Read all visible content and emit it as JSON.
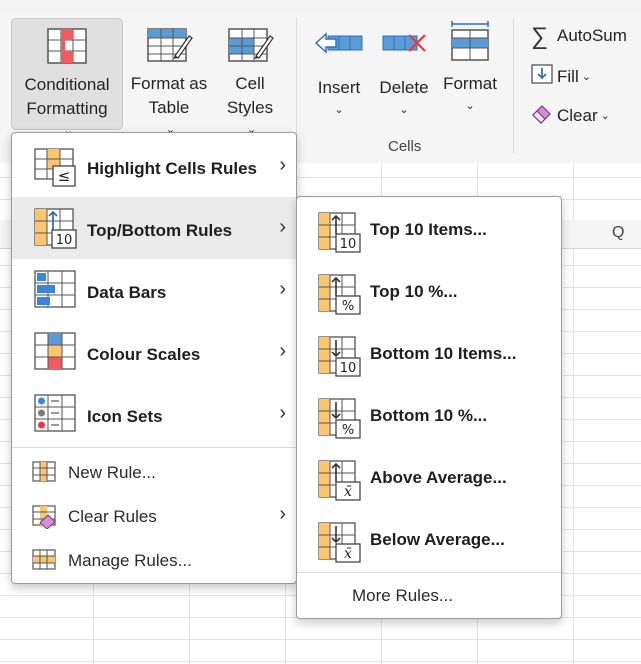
{
  "ribbon": {
    "conditional_formatting": {
      "line1": "Conditional",
      "line2": "Formatting"
    },
    "format_as_table": {
      "line1": "Format as",
      "line2": "Table"
    },
    "cell_styles": {
      "line1": "Cell",
      "line2": "Styles"
    },
    "insert": "Insert",
    "delete": "Delete",
    "format": "Format",
    "cells_group": "Cells",
    "autosum": "AutoSum",
    "fill": "Fill",
    "clear": "Clear",
    "chevron": "⌄"
  },
  "sheet": {
    "column_q": "Q"
  },
  "main_menu": {
    "items": [
      {
        "label": "Highlight Cells Rules",
        "icon": "highlight-cells-icon",
        "submenu": true
      },
      {
        "label": "Top/Bottom Rules",
        "icon": "top-bottom-icon",
        "submenu": true,
        "selected": true
      },
      {
        "label": "Data Bars",
        "icon": "data-bars-icon",
        "submenu": true
      },
      {
        "label": "Colour Scales",
        "icon": "colour-scales-icon",
        "submenu": true
      },
      {
        "label": "Icon Sets",
        "icon": "icon-sets-icon",
        "submenu": true
      }
    ],
    "actions": [
      {
        "label": "New Rule...",
        "icon": "new-rule-icon",
        "submenu": false
      },
      {
        "label": "Clear Rules",
        "icon": "clear-rules-icon",
        "submenu": true
      },
      {
        "label": "Manage Rules...",
        "icon": "manage-rules-icon",
        "submenu": false
      }
    ],
    "arrow": "›"
  },
  "sub_menu": {
    "items": [
      {
        "label": "Top 10 Items...",
        "badge": "10",
        "direction": "up"
      },
      {
        "label": "Top 10 %...",
        "badge": "%",
        "direction": "up"
      },
      {
        "label": "Bottom 10 Items...",
        "badge": "10",
        "direction": "down"
      },
      {
        "label": "Bottom 10 %...",
        "badge": "%",
        "direction": "down"
      },
      {
        "label": "Above Average...",
        "badge": "x̄",
        "direction": "up"
      },
      {
        "label": "Below Average...",
        "badge": "x̄",
        "direction": "down"
      }
    ],
    "more_rules": "More Rules..."
  },
  "colors": {
    "ribbon_bg": "#f5f5f5",
    "accent_blue": "#3a86d8",
    "accent_red": "#e8383b",
    "highlight_orange": "#fbc66e",
    "menu_hover": "#ebebeb"
  }
}
